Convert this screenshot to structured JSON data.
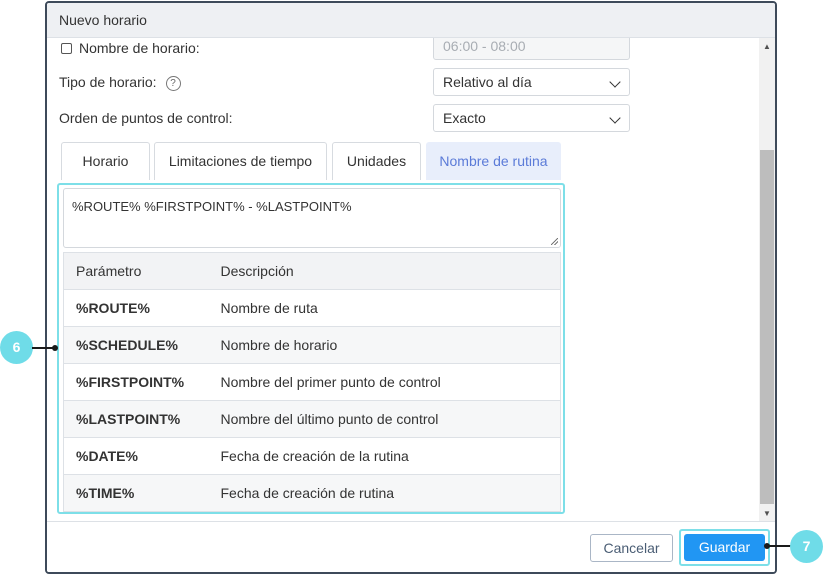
{
  "dialog": {
    "title": "Nuevo horario",
    "schedule_name": {
      "label": "Nombre de horario:",
      "checked": false,
      "value": "06:00 - 08:00"
    },
    "schedule_type": {
      "label": "Tipo de horario:",
      "help_icon": "question-circle-icon",
      "value": "Relativo al día"
    },
    "checkpoint_order": {
      "label": "Orden de puntos de control:",
      "value": "Exacto"
    },
    "tabs": [
      {
        "label": "Horario"
      },
      {
        "label": "Limitaciones de tiempo"
      },
      {
        "label": "Unidades"
      },
      {
        "label": "Nombre de rutina",
        "active": true
      }
    ],
    "template_text": "%ROUTE% %FIRSTPOINT% - %LASTPOINT%",
    "table": {
      "headers": [
        "Parámetro",
        "Descripción"
      ],
      "rows": [
        {
          "param": "%ROUTE%",
          "desc": "Nombre de ruta"
        },
        {
          "param": "%SCHEDULE%",
          "desc": "Nombre de horario"
        },
        {
          "param": "%FIRSTPOINT%",
          "desc": "Nombre del primer punto de control"
        },
        {
          "param": "%LASTPOINT%",
          "desc": "Nombre del último punto de control"
        },
        {
          "param": "%DATE%",
          "desc": "Fecha de creación de la rutina"
        },
        {
          "param": "%TIME%",
          "desc": "Fecha de creación de rutina"
        }
      ]
    },
    "footer": {
      "cancel_label": "Cancelar",
      "save_label": "Guardar"
    }
  },
  "callouts": {
    "left": "6",
    "right": "7"
  },
  "colors": {
    "accent": "#2196f3",
    "highlight": "#7ddfe8",
    "callout": "#6fdce8",
    "active_tab_text": "#5b7bd8"
  }
}
